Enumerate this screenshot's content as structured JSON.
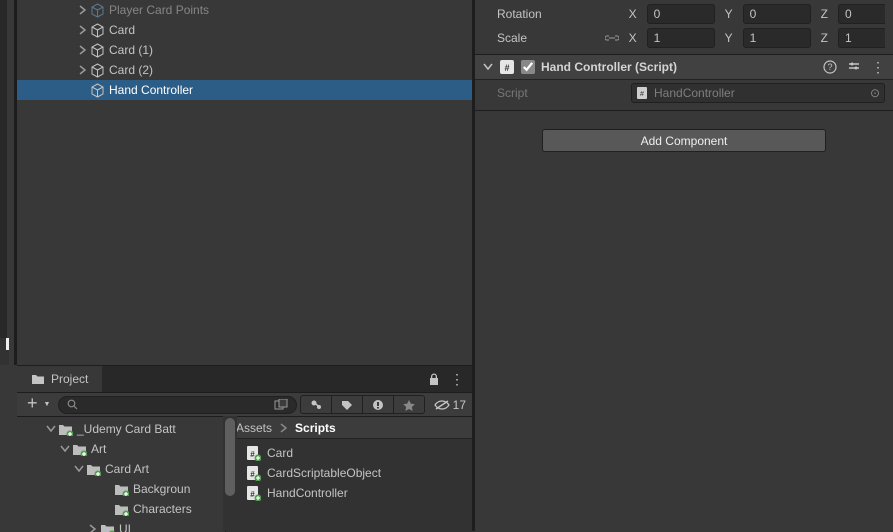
{
  "hierarchy": {
    "items": [
      {
        "label": "Player Card Points",
        "indent": 70,
        "fold": "right",
        "icon": "prefab-cube",
        "dim": true
      },
      {
        "label": "Card",
        "indent": 70,
        "fold": "right",
        "icon": "cube"
      },
      {
        "label": "Card (1)",
        "indent": 70,
        "fold": "right",
        "icon": "cube"
      },
      {
        "label": "Card (2)",
        "indent": 70,
        "fold": "right",
        "icon": "cube"
      },
      {
        "label": "Hand Controller",
        "indent": 70,
        "fold": "none",
        "icon": "cube",
        "selected": true
      }
    ]
  },
  "project": {
    "tab_label": "Project",
    "search_placeholder": "",
    "hidden_count": "17",
    "tree": [
      {
        "label": "Udemy Card Batt",
        "indent": 28,
        "fold": "down",
        "icon": "folder-plus",
        "prefix": "_"
      },
      {
        "label": "Art",
        "indent": 42,
        "fold": "down",
        "icon": "folder-plus"
      },
      {
        "label": "Card Art",
        "indent": 56,
        "fold": "down",
        "icon": "folder-plus"
      },
      {
        "label": "Backgroun",
        "indent": 84,
        "fold": "none",
        "icon": "folder-plus"
      },
      {
        "label": "Characters",
        "indent": 84,
        "fold": "none",
        "icon": "folder-plus"
      },
      {
        "label": "UI",
        "indent": 70,
        "fold": "right",
        "icon": "folder-plus"
      }
    ],
    "breadcrumb": {
      "root": "Assets",
      "current": "Scripts"
    },
    "assets": [
      {
        "label": "Card",
        "icon": "cs"
      },
      {
        "label": "CardScriptableObject",
        "icon": "cs"
      },
      {
        "label": "HandController",
        "icon": "cs"
      }
    ]
  },
  "inspector": {
    "transform": {
      "rotation_label": "Rotation",
      "scale_label": "Scale",
      "rotation": {
        "x": "0",
        "y": "0",
        "z": "0"
      },
      "scale": {
        "x": "1",
        "y": "1",
        "z": "1"
      }
    },
    "component": {
      "title": "Hand Controller (Script)",
      "script_label": "Script",
      "script_value": "HandController"
    },
    "add_component_label": "Add Component"
  }
}
